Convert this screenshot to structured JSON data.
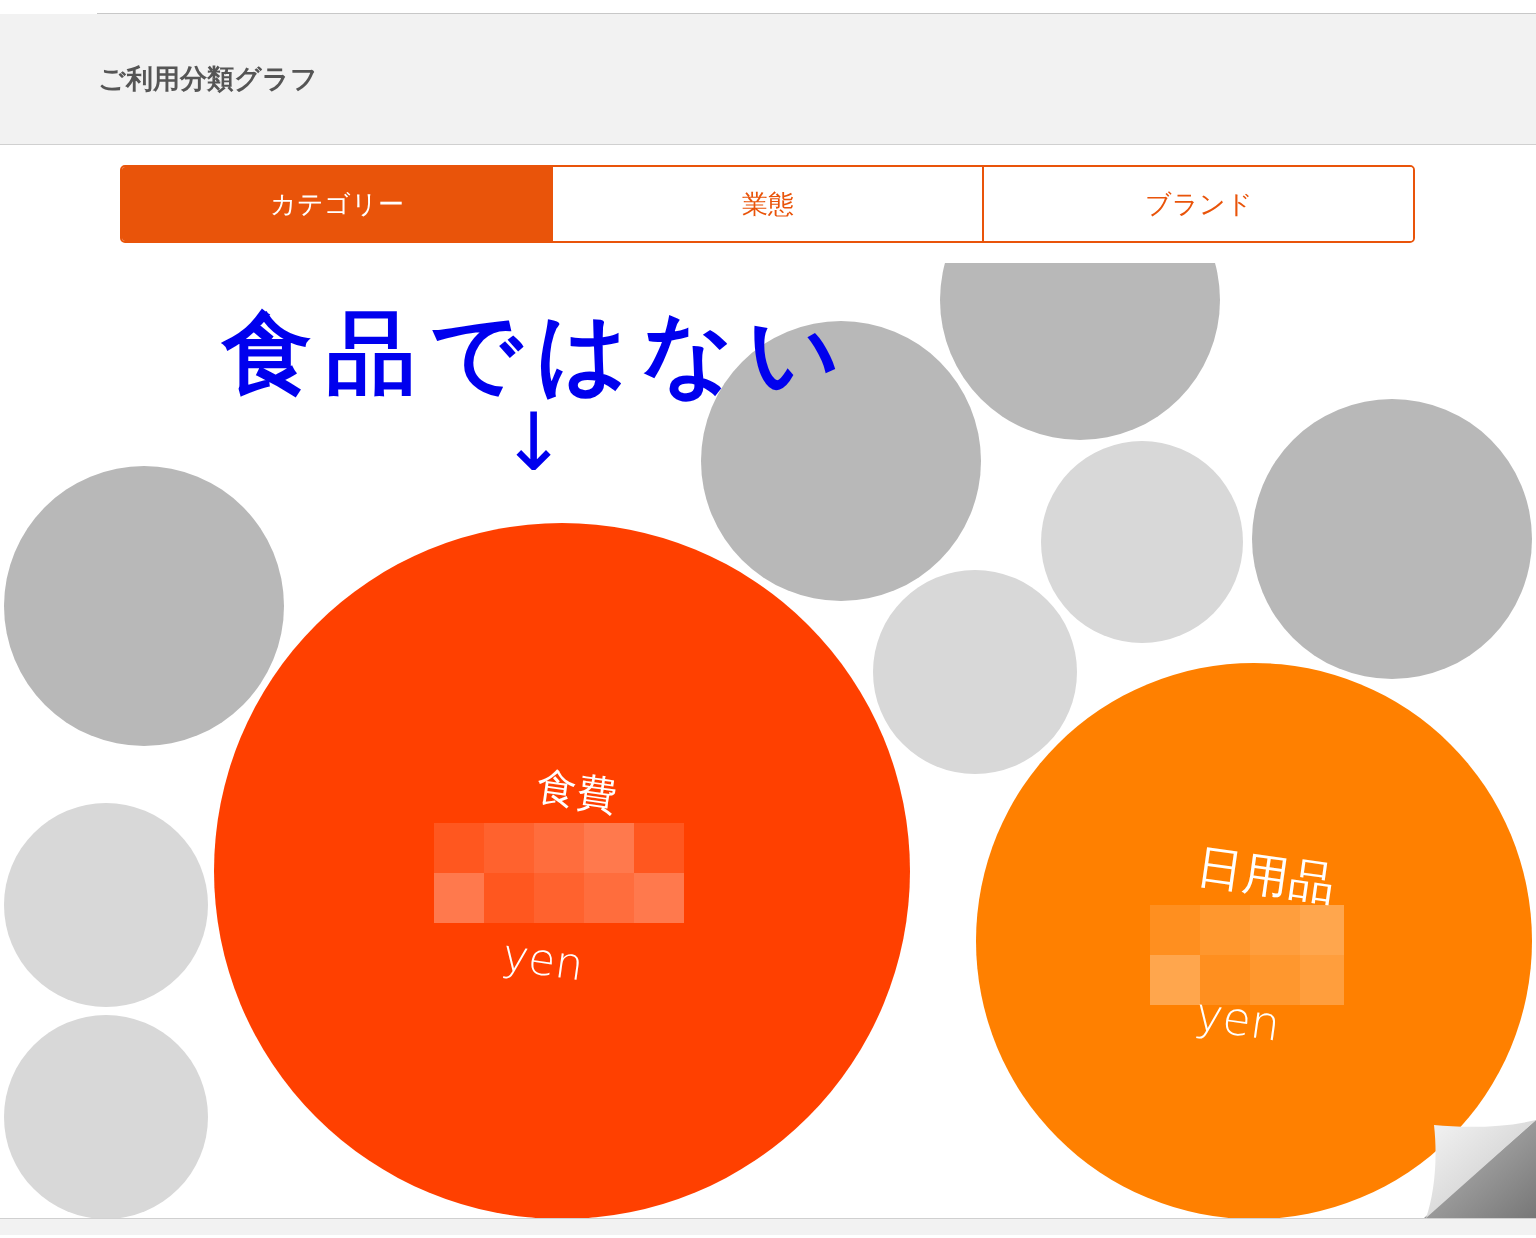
{
  "header": {
    "title": "ご利用分類グラフ"
  },
  "tabs": [
    {
      "label": "カテゴリー",
      "selected": true
    },
    {
      "label": "業態",
      "selected": false
    },
    {
      "label": "ブランド",
      "selected": false
    }
  ],
  "annotation": {
    "text": "食品ではない",
    "arrow": "↓"
  },
  "bubbles": [
    {
      "color": "#b8b8b8"
    },
    {
      "color": "#b8b8b8"
    },
    {
      "color": "#b8b8b8"
    },
    {
      "color": "#d8d8d8"
    },
    {
      "color": "#b8b8b8"
    },
    {
      "color": "#d8d8d8"
    },
    {
      "color": "#d8d8d8"
    },
    {
      "color": "#d8d8d8"
    },
    {
      "color": "#ff4000",
      "label": "食費",
      "unit": "yen"
    },
    {
      "color": "#ff8000",
      "label": "日用品",
      "unit": "yen"
    }
  ]
}
